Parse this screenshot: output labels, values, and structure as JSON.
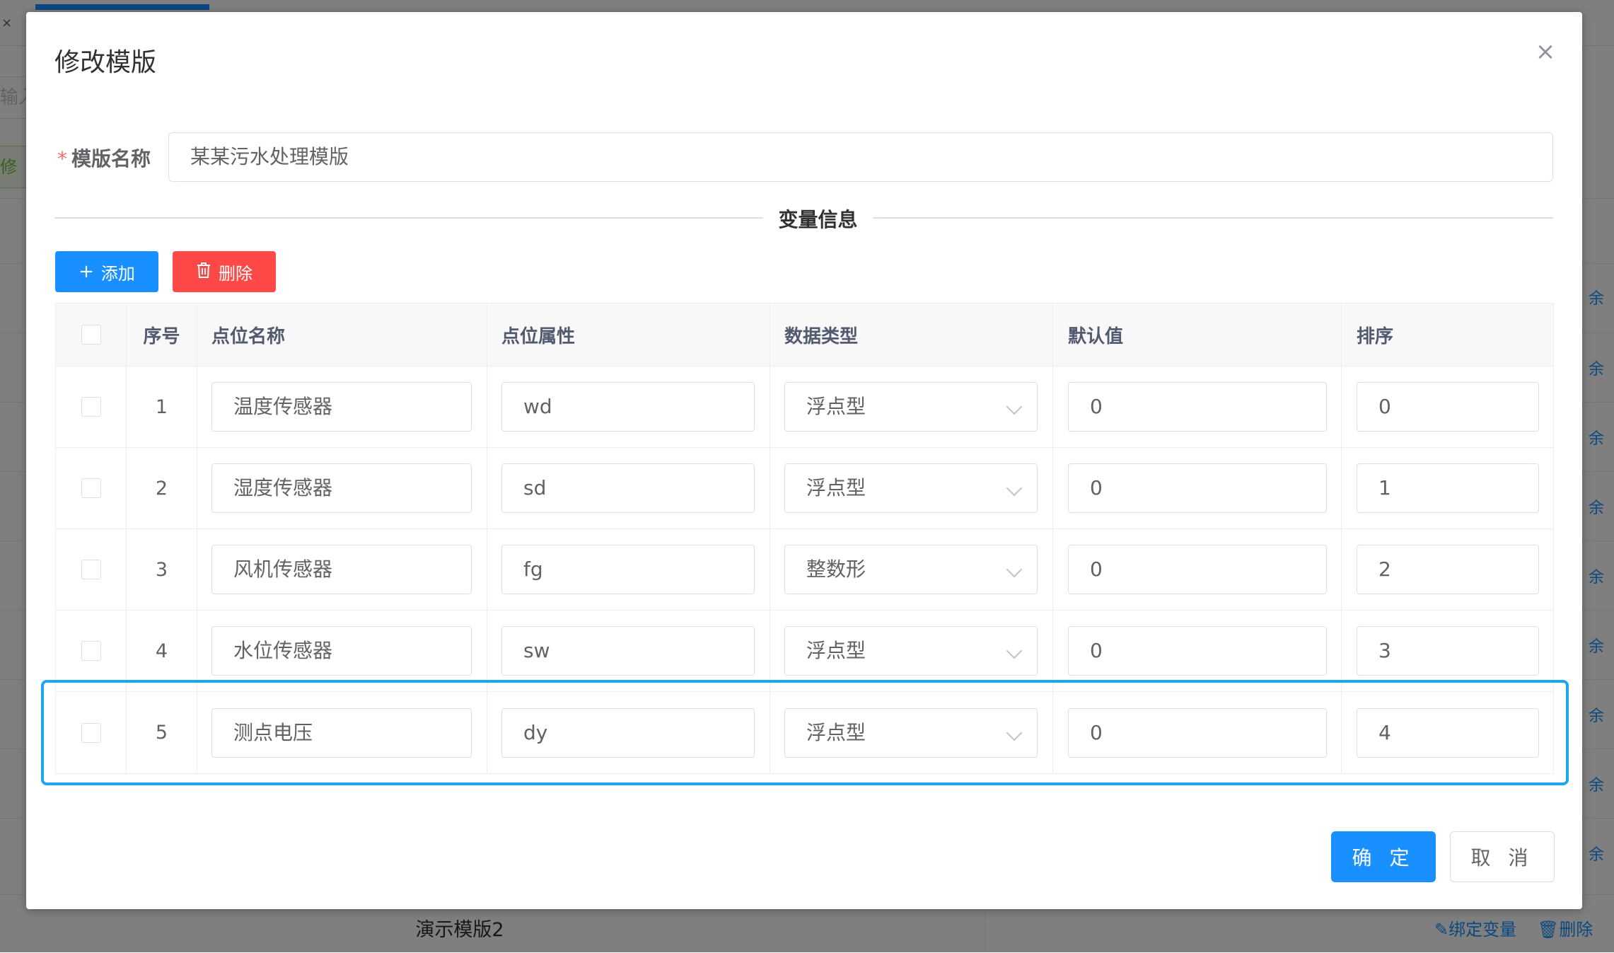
{
  "background": {
    "tab_close": "×",
    "search_placeholder": "输入",
    "edit_button": "修",
    "right_link": "余",
    "bottom_row": {
      "name": "演示模版2",
      "bind_label": "绑定变量",
      "delete_label": "删除"
    }
  },
  "dialog": {
    "title": "修改模版",
    "close_icon": "×",
    "form": {
      "required_mark": "*",
      "name_label": "模版名称",
      "name_value": "某某污水处理模版"
    },
    "divider": "变量信息",
    "toolbar": {
      "add_icon": "+",
      "add_label": "添加",
      "delete_icon": "trash-icon",
      "delete_label": "删除"
    },
    "table": {
      "headers": [
        "序号",
        "点位名称",
        "点位属性",
        "数据类型",
        "默认值",
        "排序"
      ],
      "rows": [
        {
          "index": "1",
          "name": "温度传感器",
          "attr": "wd",
          "type": "浮点型",
          "default": "0",
          "sort": "0"
        },
        {
          "index": "2",
          "name": "湿度传感器",
          "attr": "sd",
          "type": "浮点型",
          "default": "0",
          "sort": "1"
        },
        {
          "index": "3",
          "name": "风机传感器",
          "attr": "fg",
          "type": "整数形",
          "default": "0",
          "sort": "2"
        },
        {
          "index": "4",
          "name": "水位传感器",
          "attr": "sw",
          "type": "浮点型",
          "default": "0",
          "sort": "3"
        },
        {
          "index": "5",
          "name": "测点电压",
          "attr": "dy",
          "type": "浮点型",
          "default": "0",
          "sort": "4"
        }
      ]
    },
    "footer": {
      "confirm_label": "确 定",
      "cancel_label": "取 消"
    }
  },
  "colors": {
    "primary": "#1890ff",
    "danger": "#ff4949",
    "highlight": "#1da7ef",
    "required": "#f56c6c"
  }
}
